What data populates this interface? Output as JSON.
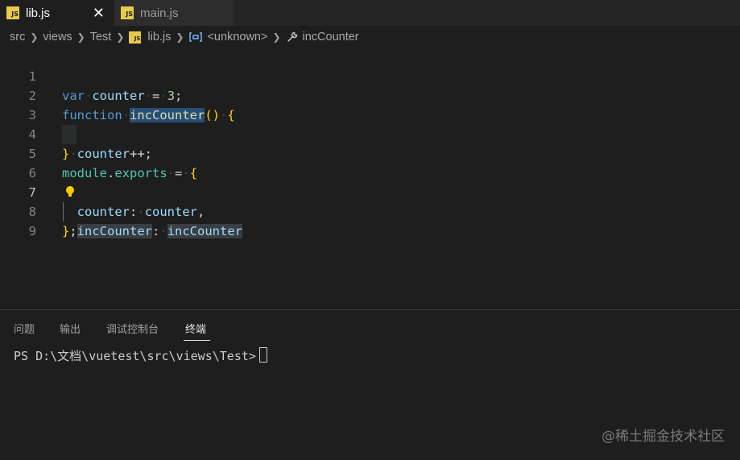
{
  "tabs": [
    {
      "label": "lib.js",
      "icon_text": "JS",
      "active": true,
      "close": "✕"
    },
    {
      "label": "main.js",
      "icon_text": "JS",
      "active": false
    }
  ],
  "breadcrumb": {
    "items": [
      "src",
      "views",
      "Test",
      "lib.js",
      "<unknown>",
      "incCounter"
    ],
    "icons": [
      "folder",
      "folder",
      "folder",
      "js-file-icon",
      "variable-icon",
      "wrench-icon"
    ]
  },
  "editor": {
    "line_numbers": [
      "1",
      "2",
      "3",
      "4",
      "5",
      "6",
      "7",
      "8",
      "9"
    ],
    "active_line": 7,
    "lines": [
      "var counter = 3;",
      "function incCounter() {",
      "  counter++;",
      "}",
      "module.exports = {",
      "  counter: counter,",
      "  incCounter: incCounter",
      "};",
      ""
    ]
  },
  "panel": {
    "tabs": [
      "问题",
      "输出",
      "调试控制台",
      "终端"
    ],
    "active_tab": "终端",
    "terminal_prompt": "PS D:\\文档\\vuetest\\src\\views\\Test>"
  },
  "watermark": "@稀土掘金技术社区",
  "colors": {
    "background": "#1e1e1e",
    "keyword": "#569cd6",
    "variable": "#9cdcfe",
    "function": "#dcdcaa",
    "number": "#b5cea8",
    "bracket": "#ffd700",
    "selection": "#264f78",
    "js_badge": "#e8c94b"
  }
}
